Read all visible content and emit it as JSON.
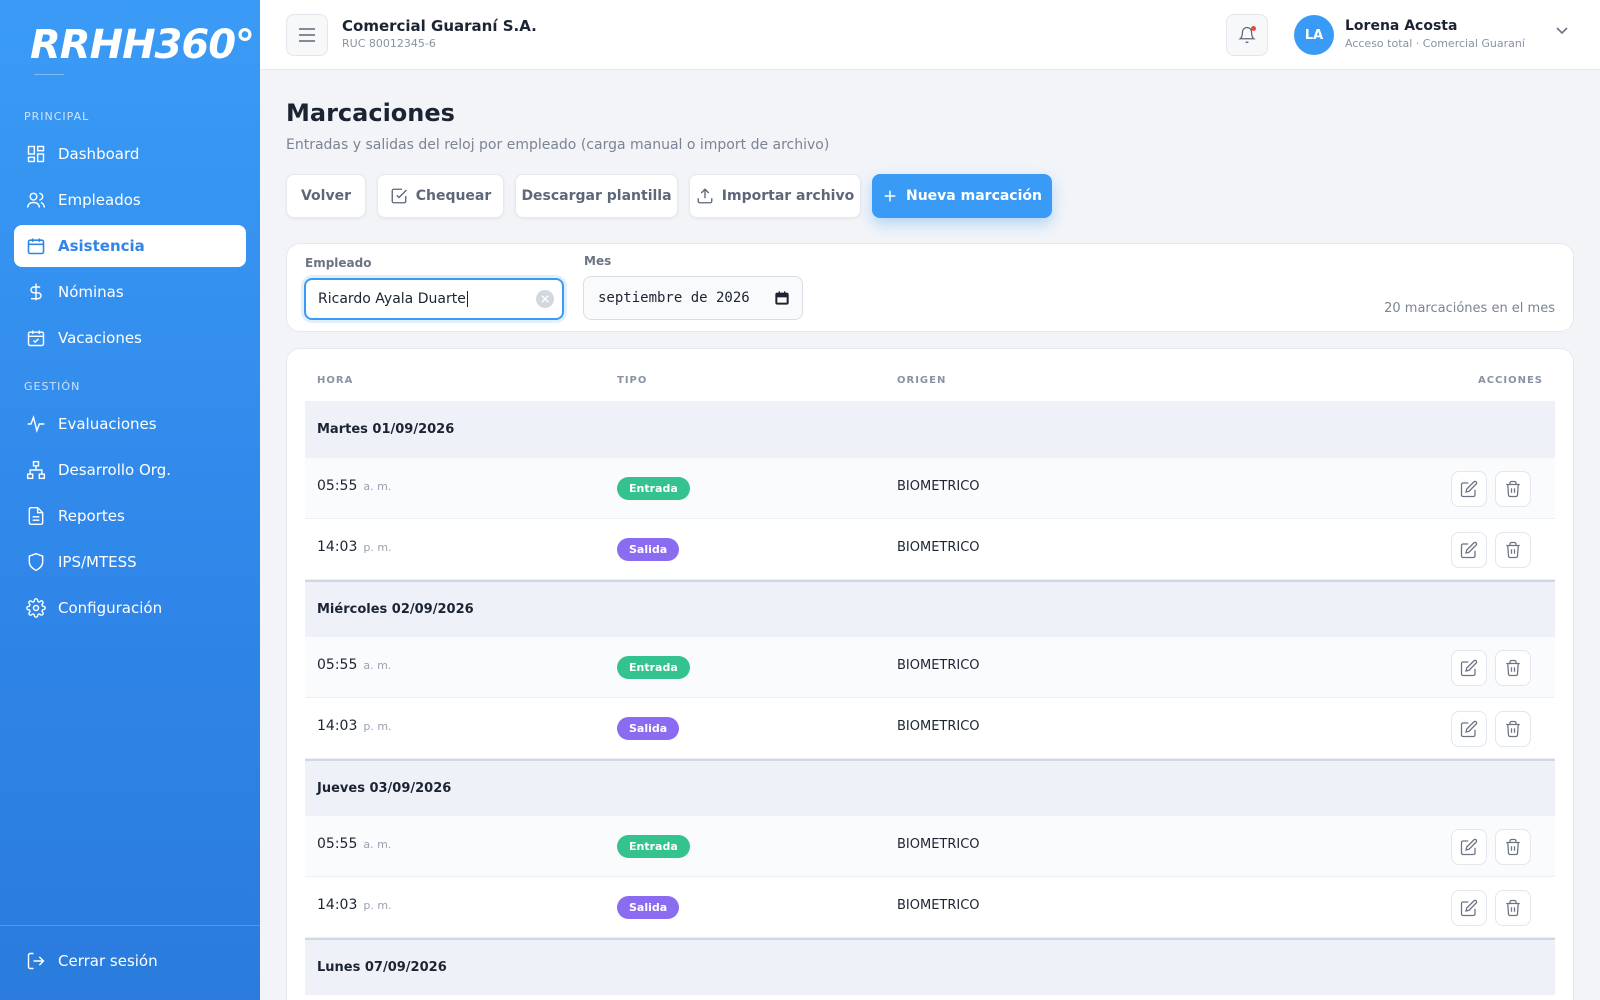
{
  "sidebar": {
    "logo": "RRHH360°",
    "section_principal": "PRINCIPAL",
    "section_gestion": "GESTIÓN",
    "items": [
      {
        "label": "Dashboard",
        "icon": "dashboard-icon"
      },
      {
        "label": "Empleados",
        "icon": "users-icon"
      },
      {
        "label": "Asistencia",
        "icon": "calendar-icon",
        "active": true
      },
      {
        "label": "Nóminas",
        "icon": "dollar-icon"
      },
      {
        "label": "Vacaciones",
        "icon": "calendar-check-icon"
      },
      {
        "label": "Evaluaciones",
        "icon": "activity-icon"
      },
      {
        "label": "Desarrollo Org.",
        "icon": "org-chart-icon"
      },
      {
        "label": "Reportes",
        "icon": "file-text-icon"
      },
      {
        "label": "IPS/MTESS",
        "icon": "shield-icon"
      },
      {
        "label": "Configuración",
        "icon": "gear-icon"
      }
    ],
    "logout_label": "Cerrar sesión"
  },
  "header": {
    "company_name": "Comercial Guaraní S.A.",
    "company_ruc": "RUC 80012345-6",
    "user_initials": "LA",
    "user_name": "Lorena Acosta",
    "user_role": "Acceso total · Comercial Guaraní"
  },
  "page": {
    "title": "Marcaciones",
    "subtitle": "Entradas y salidas del reloj por empleado (carga manual o import de archivo)"
  },
  "toolbar": {
    "back_label": "Volver",
    "check_label": "Chequear",
    "template_label": "Descargar plantilla",
    "import_label": "Importar archivo",
    "new_label": "Nueva marcación"
  },
  "filters": {
    "employee_label": "Empleado",
    "employee_value": "Ricardo Ayala Duarte",
    "month_label": "Mes",
    "month_value": "septiembre de 2026",
    "count_text": "20 marcaciónes en el mes"
  },
  "table": {
    "headers": {
      "time": "HORA",
      "type": "TIPO",
      "origin": "ORIGEN",
      "actions": "ACCIONES"
    },
    "days": [
      {
        "label": "Martes 01/09/2026",
        "entries": [
          {
            "time": "05:55",
            "ampm": "a. m.",
            "type": "Entrada",
            "kind": "in",
            "origin": "BIOMETRICO"
          },
          {
            "time": "14:03",
            "ampm": "p. m.",
            "type": "Salida",
            "kind": "out",
            "origin": "BIOMETRICO"
          }
        ]
      },
      {
        "label": "Miércoles 02/09/2026",
        "entries": [
          {
            "time": "05:55",
            "ampm": "a. m.",
            "type": "Entrada",
            "kind": "in",
            "origin": "BIOMETRICO"
          },
          {
            "time": "14:03",
            "ampm": "p. m.",
            "type": "Salida",
            "kind": "out",
            "origin": "BIOMETRICO"
          }
        ]
      },
      {
        "label": "Jueves 03/09/2026",
        "entries": [
          {
            "time": "05:55",
            "ampm": "a. m.",
            "type": "Entrada",
            "kind": "in",
            "origin": "BIOMETRICO"
          },
          {
            "time": "14:03",
            "ampm": "p. m.",
            "type": "Salida",
            "kind": "out",
            "origin": "BIOMETRICO"
          }
        ]
      },
      {
        "label": "Lunes 07/09/2026",
        "entries": []
      }
    ]
  },
  "colors": {
    "primary": "#3a9bf6",
    "entrada": "#34c28f",
    "salida": "#8b6cf0"
  }
}
